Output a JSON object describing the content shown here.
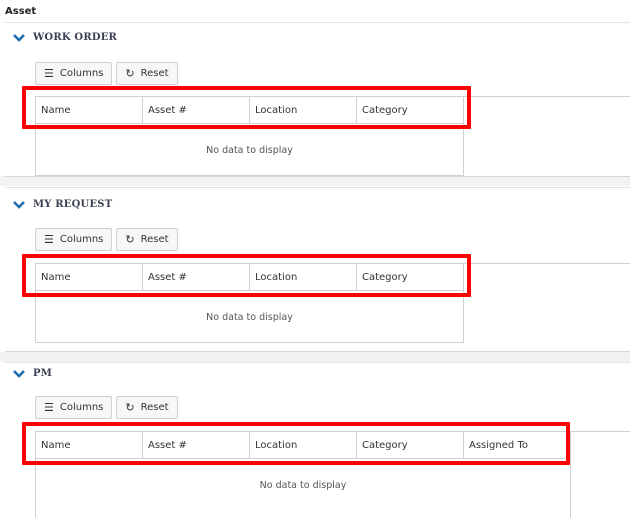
{
  "page_title": "Asset",
  "toolbar": {
    "columns_label": "Columns",
    "reset_label": "Reset"
  },
  "sections": [
    {
      "title": "WORK ORDER",
      "columns": [
        "Name",
        "Asset #",
        "Location",
        "Category"
      ],
      "empty_text": "No data to display"
    },
    {
      "title": "MY REQUEST",
      "columns": [
        "Name",
        "Asset #",
        "Location",
        "Category"
      ],
      "empty_text": "No data to display"
    },
    {
      "title": "PM",
      "columns": [
        "Name",
        "Asset #",
        "Location",
        "Category",
        "Assigned To"
      ],
      "empty_text": "No data to display"
    }
  ],
  "colors": {
    "highlight": "#ff0000",
    "header_text": "#3a3f52",
    "chevron": "#1f6fb5"
  }
}
